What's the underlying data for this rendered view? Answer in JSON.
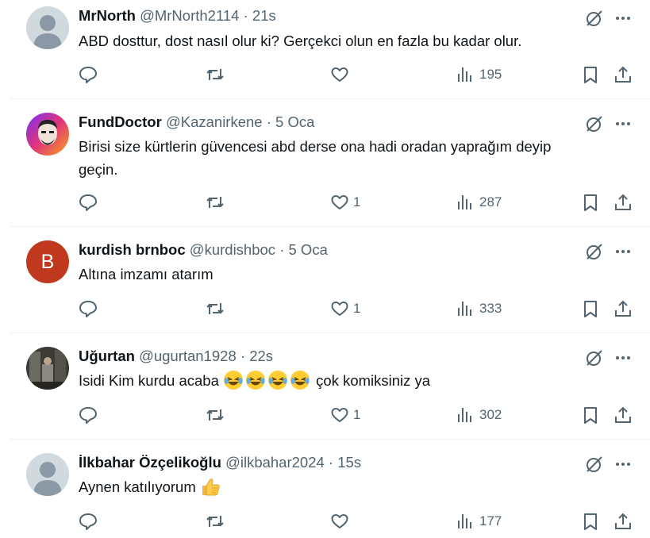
{
  "tweets": [
    {
      "name": "MrNorth",
      "handle": "@MrNorth2114",
      "time": "21s",
      "text": "ABD dosttur, dost nasıl olur ki? Gerçekci olun en fazla bu kadar olur.",
      "text_line2": "",
      "likes": "",
      "views": "195",
      "avatar": "default-avatar"
    },
    {
      "name": "FundDoctor",
      "handle": "@Kazanirkene",
      "time": "5 Oca",
      "text": "Birisi size kürtlerin güvencesi abd derse ona hadi oradan yaprağım deyip",
      "text_line2": "geçin.",
      "likes": "1",
      "views": "287",
      "avatar": "photo-avatar"
    },
    {
      "name": "kurdish brnboc",
      "handle": "@kurdishboc",
      "time": "5 Oca",
      "text": "Altına imzamı atarım",
      "text_line2": "",
      "likes": "1",
      "views": "333",
      "avatar": "letter-avatar",
      "avatar_letter": "B"
    },
    {
      "name": "Uğurtan",
      "handle": "@ugurtan1928",
      "time": "22s",
      "text": "Isidi Kim kurdu acaba",
      "text_after_emoji": "çok komiksiniz ya",
      "likes": "1",
      "views": "302",
      "avatar": "photo-avatar"
    },
    {
      "name": "İlkbahar Özçelikoğlu",
      "handle": "@ilkbahar2024",
      "time": "15s",
      "text": "Aynen katılıyorum",
      "likes": "",
      "views": "177",
      "avatar": "default-avatar"
    }
  ],
  "separator": "·",
  "colors": {
    "text": "#0f1419",
    "muted": "#536471",
    "divider": "#eff3f4",
    "letter_avatar_bg": "#c0391e",
    "default_avatar_bg": "#cfd9de"
  },
  "icons": [
    "reply-icon",
    "retweet-icon",
    "like-icon",
    "views-icon",
    "bookmark-icon",
    "share-icon",
    "grok-icon",
    "more-icon",
    "laughing-emoji",
    "thumbs-up-emoji"
  ]
}
